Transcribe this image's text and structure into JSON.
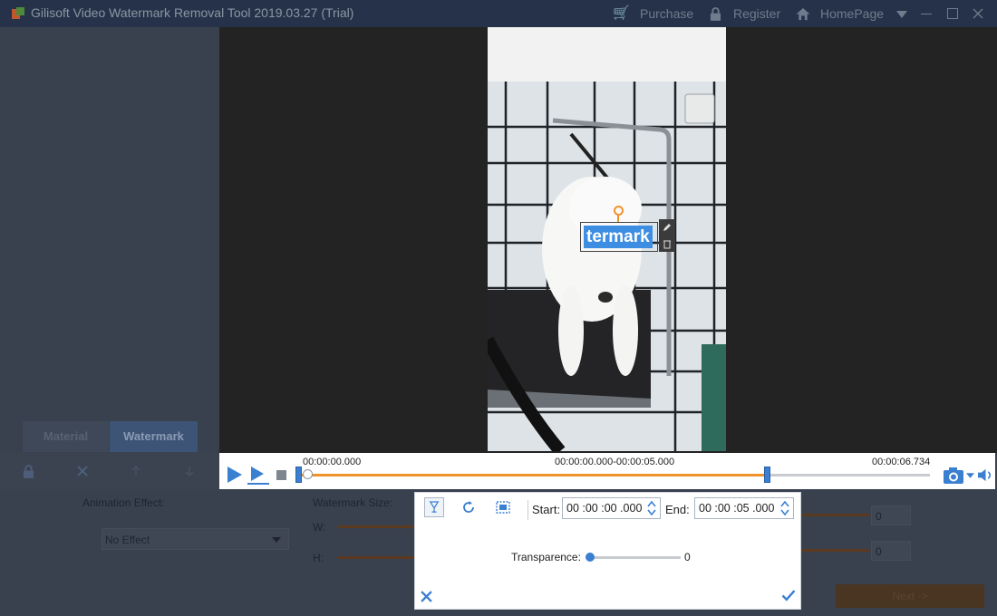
{
  "window": {
    "title": "Gilisoft Video Watermark Removal Tool 2019.03.27 (Trial)",
    "menu": {
      "purchase": "Purchase",
      "register": "Register",
      "homepage": "HomePage"
    }
  },
  "tabs": {
    "material": "Material",
    "watermark": "Watermark"
  },
  "watermark_overlay": {
    "text": "termark"
  },
  "player": {
    "current_time": "00:00:00.000",
    "range": "00:00:00.000-00:00:05.000",
    "total_time": "00:00:06.734",
    "range_start_fraction": 0.0,
    "range_end_fraction": 0.742
  },
  "settings": {
    "animation_effect_label": "Animation Effect:",
    "animation_effect_value": "No Effect",
    "watermark_size_label": "Watermark Size:",
    "w_label": "W:",
    "h_label": "H:",
    "w_value": "0",
    "h_value": "0",
    "next_button": "Next ->"
  },
  "dialog": {
    "start_label": "Start:",
    "start_value": "00 :00 :00 .000",
    "end_label": "End:",
    "end_value": "00 :00 :05 .000",
    "transparence_label": "Transparence:",
    "transparence_value": "0"
  },
  "colors": {
    "accent_blue": "#3a7fd0",
    "timeline_orange": "#f0922a",
    "titlebar": "#253249"
  }
}
